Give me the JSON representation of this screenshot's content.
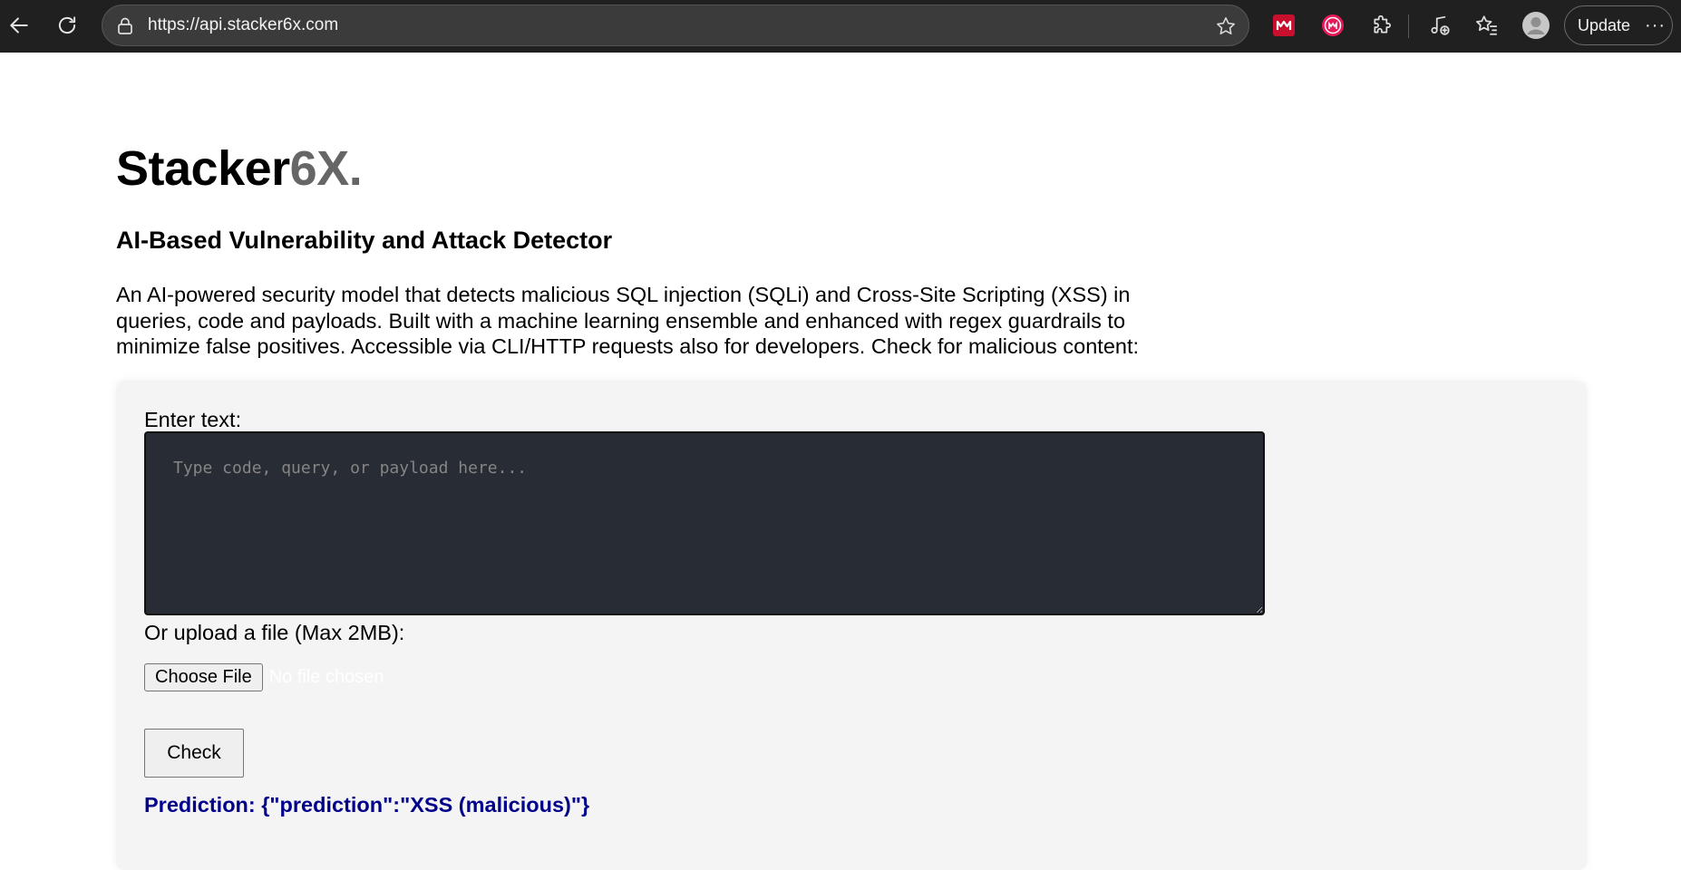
{
  "browser": {
    "url": "https://api.stacker6x.com",
    "update_label": "Update",
    "more_label": "···"
  },
  "page": {
    "logo_main": "Stacker",
    "logo_accent": "6X.",
    "subtitle": "AI-Based Vulnerability and Attack Detector",
    "description": "An AI-powered security model that detects malicious SQL injection (SQLi) and Cross-Site Scripting (XSS) in queries, code and payloads. Built with a machine learning ensemble and enhanced with regex guardrails to minimize false positives. Accessible via CLI/HTTP requests also for developers. Check for malicious content:"
  },
  "form": {
    "text_label": "Enter text:",
    "text_placeholder": "Type code, query, or payload here...",
    "text_value": "",
    "upload_label": "Or upload a file (Max 2MB):",
    "choose_file_label": "Choose File",
    "no_file_text": "No file chosen",
    "check_label": "Check",
    "prediction_text": "Prediction: {\"prediction\":\"XSS (malicious)\"}"
  },
  "colors": {
    "chrome_bg": "#202020",
    "logo_accent": "#666666",
    "editor_bg": "#282c34",
    "prediction": "#00008b"
  }
}
